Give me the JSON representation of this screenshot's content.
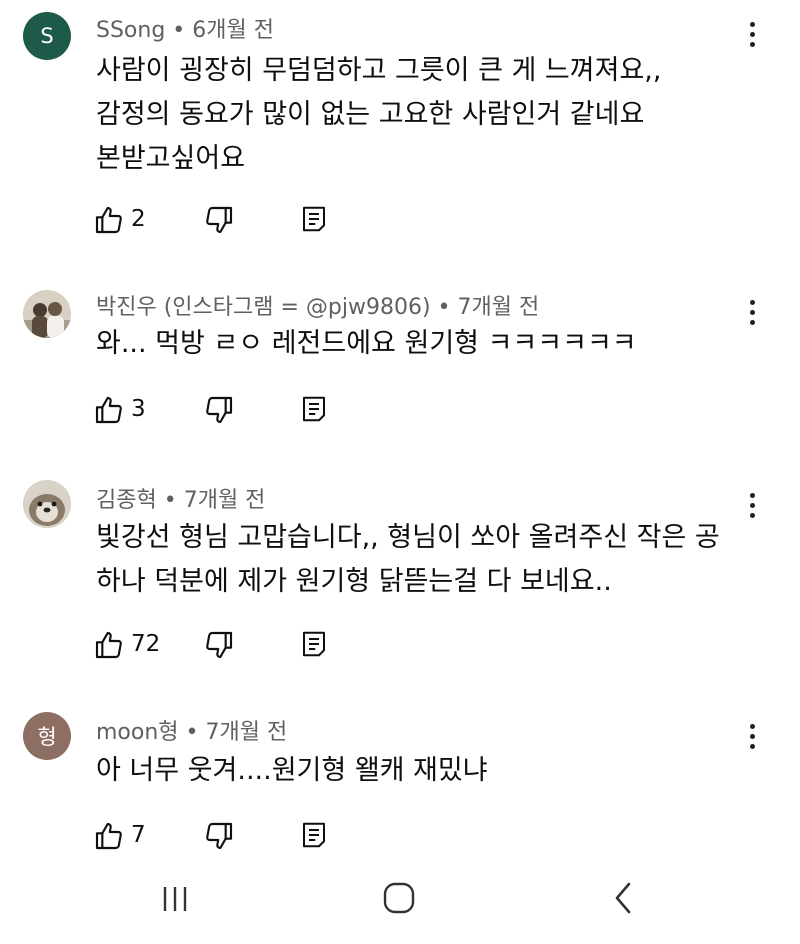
{
  "comments": [
    {
      "avatar_letter": "S",
      "avatar_color": "#1e5a4a",
      "author": "SSong",
      "time": "6개월 전",
      "lines": [
        "사람이 굉장히 무덤덤하고 그릇이 큰 게 느껴져요,,",
        "감정의 동요가 많이 없는 고요한 사람인거 같네요",
        "본받고싶어요"
      ],
      "likes": "2"
    },
    {
      "avatar_type": "photo",
      "author": "박진우 (인스타그램 = @pjw9806)",
      "time": "7개월 전",
      "lines": [
        "와... 먹방 ㄹㅇ 레전드에요 원기형 ㅋㅋㅋㅋㅋㅋ"
      ],
      "likes": "3"
    },
    {
      "avatar_type": "otter-photo",
      "author": "김종혁",
      "time": "7개월 전",
      "lines": [
        "빛강선 형님 고맙습니다,, 형님이 쏘아 올려주신 작은 공",
        "하나 덕분에 제가 원기형 닭뜯는걸 다 보네요.."
      ],
      "likes": "72"
    },
    {
      "avatar_letter": "형",
      "avatar_color": "#8d6e63",
      "author": "moon형",
      "time": "7개월 전",
      "lines": [
        "아 너무 웃겨....원기형 왤캐 재밌냐"
      ],
      "likes": "7"
    }
  ],
  "sep": " • ",
  "icons": {
    "like": "thumbs-up-icon",
    "dislike": "thumbs-down-icon",
    "reply": "reply-icon",
    "more": "more-vertical-icon",
    "recents": "recents-icon",
    "home": "home-icon",
    "back": "back-icon"
  }
}
